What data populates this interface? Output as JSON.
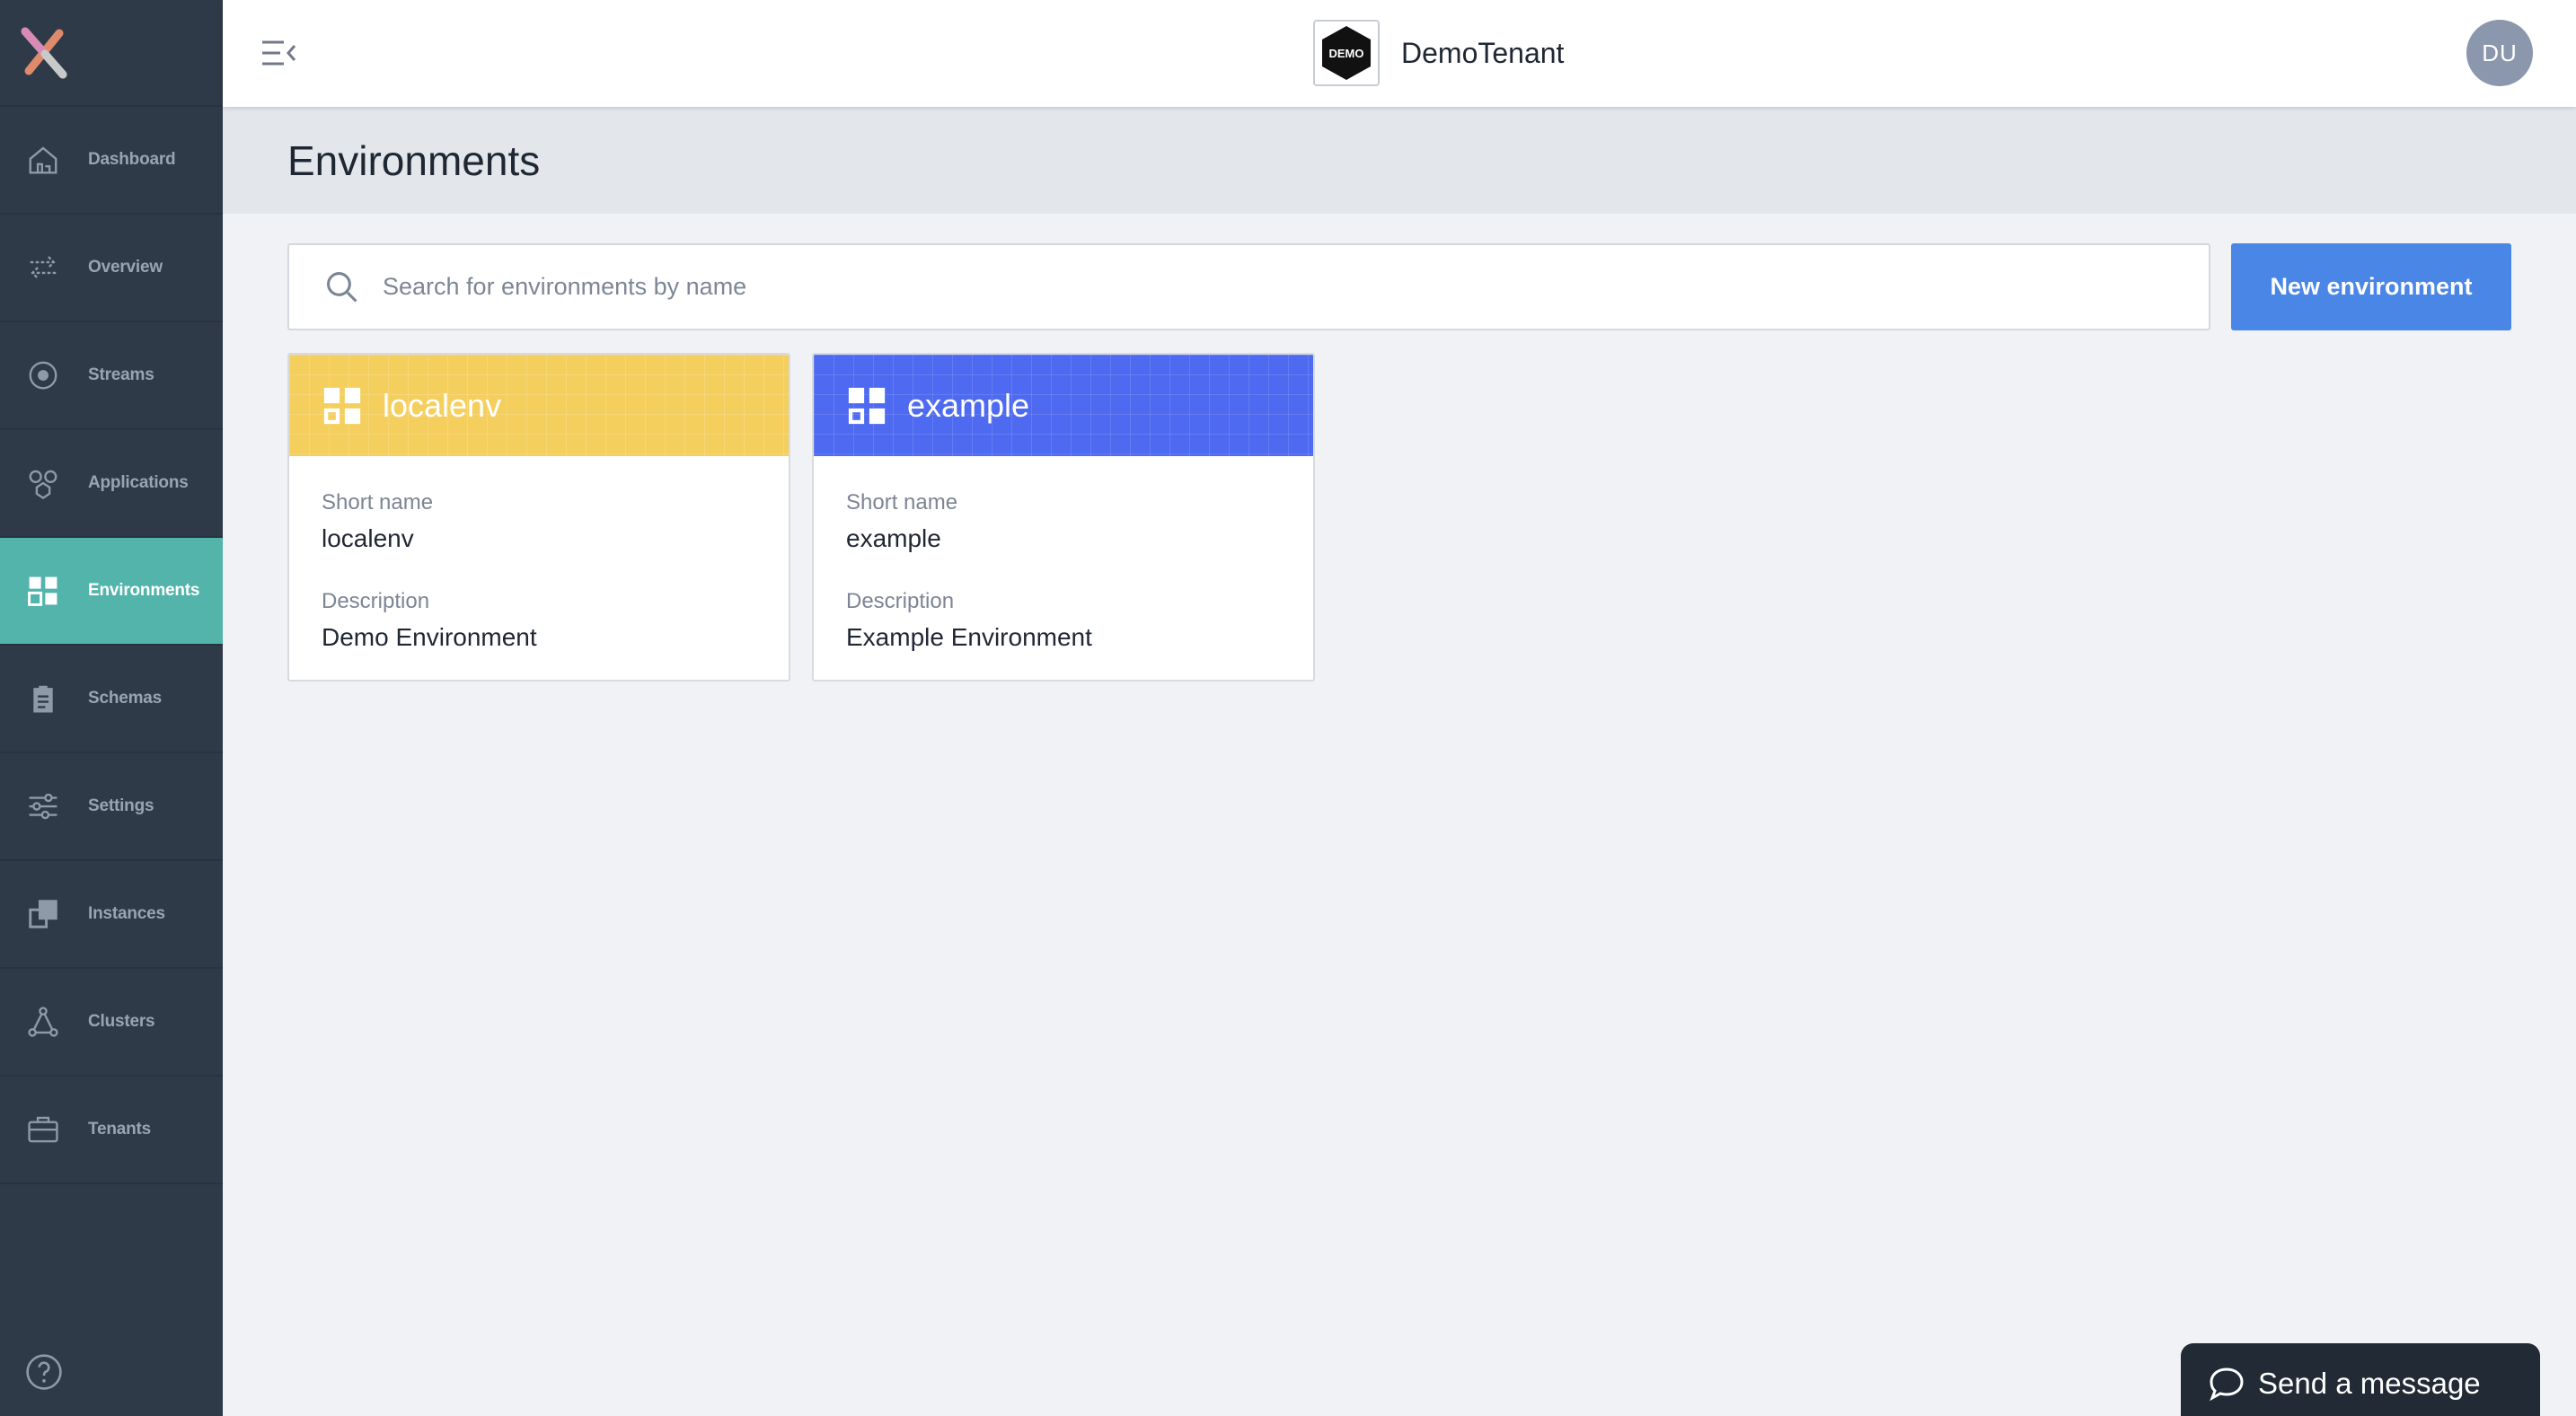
{
  "header": {
    "tenant_name": "DemoTenant",
    "tenant_logo_text": "DEMO",
    "user_initials": "DU"
  },
  "sidebar": {
    "items": [
      {
        "label": "Dashboard",
        "icon": "home-icon"
      },
      {
        "label": "Overview",
        "icon": "arrows-exchange-icon"
      },
      {
        "label": "Streams",
        "icon": "stream-circle-icon"
      },
      {
        "label": "Applications",
        "icon": "applications-icon"
      },
      {
        "label": "Environments",
        "icon": "grid-icon",
        "active": true
      },
      {
        "label": "Schemas",
        "icon": "clipboard-icon"
      },
      {
        "label": "Settings",
        "icon": "sliders-icon"
      },
      {
        "label": "Instances",
        "icon": "instances-icon"
      },
      {
        "label": "Clusters",
        "icon": "cluster-icon"
      },
      {
        "label": "Tenants",
        "icon": "briefcase-icon"
      }
    ],
    "help_icon": "help-icon"
  },
  "page": {
    "title": "Environments"
  },
  "search": {
    "placeholder": "Search for environments by name",
    "value": ""
  },
  "toolbar": {
    "new_label": "New environment"
  },
  "environments": [
    {
      "name": "localenv",
      "color": "#f5cf5e",
      "short_name_label": "Short name",
      "short_name": "localenv",
      "description_label": "Description",
      "description": "Demo Environment"
    },
    {
      "name": "example",
      "color": "#4e6af0",
      "short_name_label": "Short name",
      "short_name": "example",
      "description_label": "Description",
      "description": "Example Environment"
    }
  ],
  "chat": {
    "label": "Send a message"
  },
  "colors": {
    "sidebar": "#2f3a48",
    "accent": "#52b4ab",
    "primary_button": "#4a86e6"
  }
}
